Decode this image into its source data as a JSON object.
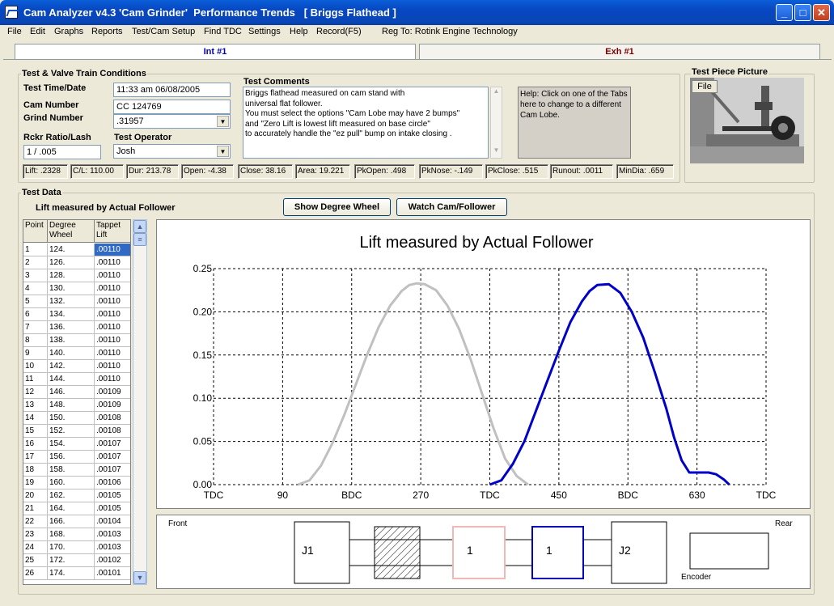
{
  "window": {
    "title": "Cam Analyzer v4.3 'Cam Grinder'  Performance Trends   [ Briggs Flathead ]"
  },
  "menu": [
    "File",
    "Edit",
    "Graphs",
    "Reports",
    "Test/Cam Setup",
    "Find TDC",
    "Settings",
    "Help",
    "Record(F5)"
  ],
  "reg": "Reg To: Rotink Engine Technology",
  "tabs": {
    "int": "Int #1",
    "exh": "Exh #1"
  },
  "conditions": {
    "group_label": "Test & Valve Train Conditions",
    "time_label": "Test Time/Date",
    "time_value": "11:33 am  06/08/2005",
    "cam_label": "Cam Number",
    "cam_value": "CC 124769",
    "grind_label": "Grind Number",
    "grind_value": ".31957",
    "rckr_label": "Rckr Ratio/Lash",
    "rckr_value": "1  /  .005",
    "operator_label": "Test Operator",
    "operator_value": "Josh",
    "comments_label": "Test Comments",
    "comments": [
      "Briggs flathead measured on cam stand with",
      "universal flat follower.",
      "You must select the options \"Cam Lobe may have 2 bumps\"",
      "and \"Zero Lift is lowest lift measured on base circle\"",
      "to accurately handle the \"ez pull\" bump on  intake closing ."
    ],
    "help": "Help:  Click on one of the Tabs here to change to a different Cam Lobe."
  },
  "stats": [
    "Lift: .2328",
    "C/L: 110.00",
    "Dur: 213.78",
    "Open: -4.38",
    "Close: 38.16",
    "Area: 19.221",
    "PkOpen: .498",
    "PkNose: -.149",
    "PkClose: .515",
    "Runout: .0011",
    "MinDia: .659"
  ],
  "picture": {
    "label": "Test Piece Picture",
    "file_button": "File"
  },
  "test_data": {
    "group_label": "Test Data",
    "subtitle": "Lift measured by Actual Follower",
    "show_wheel": "Show Degree Wheel",
    "watch_cam": "Watch Cam/Follower",
    "headers": [
      "Point",
      "Degree Wheel",
      "Tappet Lift"
    ],
    "rows": [
      [
        "1",
        "124.",
        ".00110"
      ],
      [
        "2",
        "126.",
        ".00110"
      ],
      [
        "3",
        "128.",
        ".00110"
      ],
      [
        "4",
        "130.",
        ".00110"
      ],
      [
        "5",
        "132.",
        ".00110"
      ],
      [
        "6",
        "134.",
        ".00110"
      ],
      [
        "7",
        "136.",
        ".00110"
      ],
      [
        "8",
        "138.",
        ".00110"
      ],
      [
        "9",
        "140.",
        ".00110"
      ],
      [
        "10",
        "142.",
        ".00110"
      ],
      [
        "11",
        "144.",
        ".00110"
      ],
      [
        "12",
        "146.",
        ".00109"
      ],
      [
        "13",
        "148.",
        ".00109"
      ],
      [
        "14",
        "150.",
        ".00108"
      ],
      [
        "15",
        "152.",
        ".00108"
      ],
      [
        "16",
        "154.",
        ".00107"
      ],
      [
        "17",
        "156.",
        ".00107"
      ],
      [
        "18",
        "158.",
        ".00107"
      ],
      [
        "19",
        "160.",
        ".00106"
      ],
      [
        "20",
        "162.",
        ".00105"
      ],
      [
        "21",
        "164.",
        ".00105"
      ],
      [
        "22",
        "166.",
        ".00104"
      ],
      [
        "23",
        "168.",
        ".00103"
      ],
      [
        "24",
        "170.",
        ".00103"
      ],
      [
        "25",
        "172.",
        ".00102"
      ],
      [
        "26",
        "174.",
        ".00101"
      ]
    ]
  },
  "chart_data": {
    "type": "line",
    "title": "Lift measured by Actual Follower",
    "xlim": [
      0,
      720
    ],
    "ylim": [
      0,
      0.25
    ],
    "x_ticks": [
      "TDC",
      "90",
      "BDC",
      "270",
      "TDC",
      "450",
      "BDC",
      "630",
      "TDC"
    ],
    "y_ticks": [
      "0.25",
      "0.20",
      "0.15",
      "0.10",
      "0.05",
      "0.00"
    ],
    "grid": true,
    "series": [
      {
        "color": "#c0c0c0",
        "x": [
          110,
          125,
          140,
          155,
          170,
          185,
          200,
          215,
          230,
          245,
          255,
          265,
          275,
          290,
          305,
          320,
          335,
          350,
          365,
          380,
          395,
          410
        ],
        "y": [
          0,
          0.005,
          0.022,
          0.048,
          0.08,
          0.115,
          0.15,
          0.182,
          0.207,
          0.224,
          0.231,
          0.233,
          0.232,
          0.225,
          0.207,
          0.18,
          0.145,
          0.105,
          0.065,
          0.03,
          0.01,
          0
        ]
      },
      {
        "color": "#0000c8",
        "x": [
          360,
          375,
          390,
          405,
          420,
          435,
          450,
          465,
          480,
          490,
          500,
          515,
          530,
          545,
          560,
          575,
          590,
          600,
          610,
          620,
          635,
          645,
          655,
          665,
          672
        ],
        "y": [
          0,
          0.005,
          0.024,
          0.05,
          0.085,
          0.12,
          0.155,
          0.188,
          0.212,
          0.224,
          0.231,
          0.232,
          0.222,
          0.2,
          0.17,
          0.13,
          0.088,
          0.055,
          0.028,
          0.014,
          0.014,
          0.014,
          0.012,
          0.006,
          0
        ]
      }
    ]
  },
  "engine": {
    "front": "Front",
    "rear": "Rear",
    "encoder": "Encoder",
    "j1": "J1",
    "j2": "J2",
    "lobe1": "1",
    "lobe2": "1"
  }
}
